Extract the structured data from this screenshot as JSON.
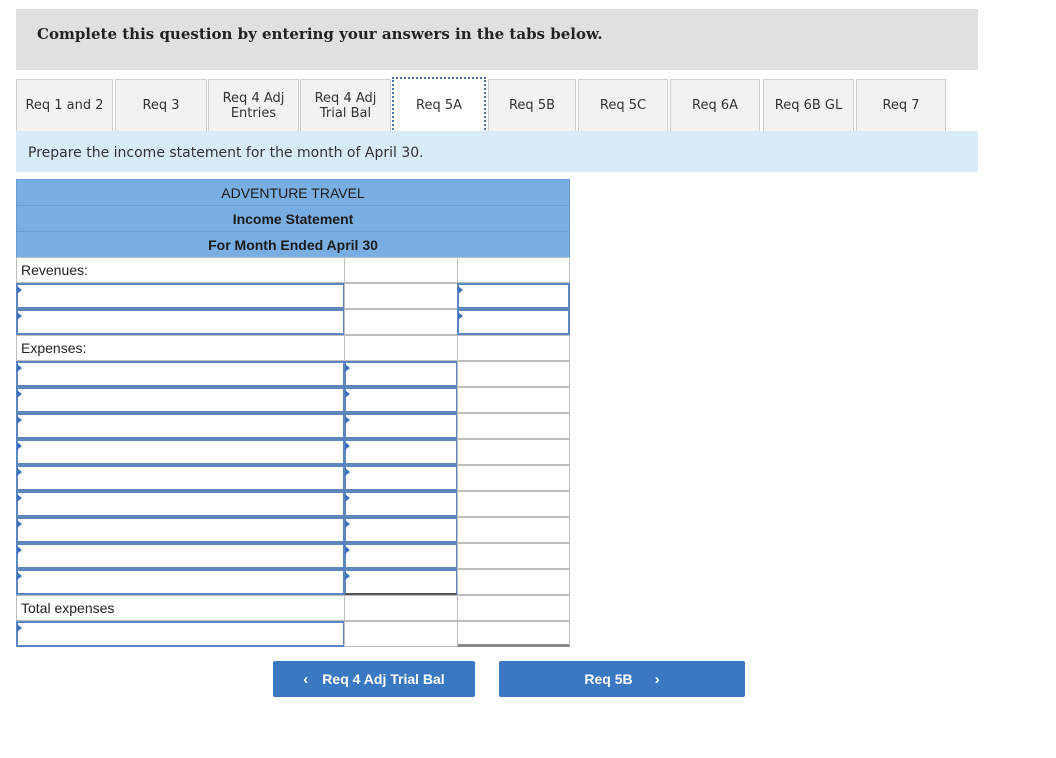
{
  "instructions": "Complete this question by entering your answers in the tabs below.",
  "tabs": [
    {
      "label": "Req 1 and 2",
      "active": false
    },
    {
      "label": "Req 3",
      "active": false
    },
    {
      "label": "Req 4 Adj Entries",
      "line1": "Req 4 Adj",
      "line2": "Entries",
      "active": false
    },
    {
      "label": "Req 4 Adj Trial Bal",
      "line1": "Req 4 Adj",
      "line2": "Trial Bal",
      "active": false
    },
    {
      "label": "Req 5A",
      "active": true
    },
    {
      "label": "Req 5B",
      "active": false
    },
    {
      "label": "Req 5C",
      "active": false
    },
    {
      "label": "Req 6A",
      "active": false
    },
    {
      "label": "Req 6B GL",
      "active": false
    },
    {
      "label": "Req 7",
      "active": false
    }
  ],
  "prompt": "Prepare the income statement for the month of April 30.",
  "statement": {
    "company": "ADVENTURE TRAVEL",
    "title": "Income Statement",
    "period": "For Month Ended April 30",
    "revenues_label": "Revenues:",
    "expenses_label": "Expenses:",
    "total_expenses_label": "Total expenses",
    "revenue_rows": [
      {
        "account": "",
        "amount": ""
      },
      {
        "account": "",
        "amount": ""
      }
    ],
    "expense_rows": [
      {
        "account": "",
        "amount": ""
      },
      {
        "account": "",
        "amount": ""
      },
      {
        "account": "",
        "amount": ""
      },
      {
        "account": "",
        "amount": ""
      },
      {
        "account": "",
        "amount": ""
      },
      {
        "account": "",
        "amount": ""
      },
      {
        "account": "",
        "amount": ""
      },
      {
        "account": "",
        "amount": ""
      },
      {
        "account": "",
        "amount": ""
      }
    ],
    "total_expenses_value": "",
    "net_income_label": "",
    "net_income_value": ""
  },
  "nav": {
    "prev_label": "Req 4 Adj Trial Bal",
    "prev_icon": "‹",
    "next_label": "Req 5B",
    "next_icon": "›"
  }
}
